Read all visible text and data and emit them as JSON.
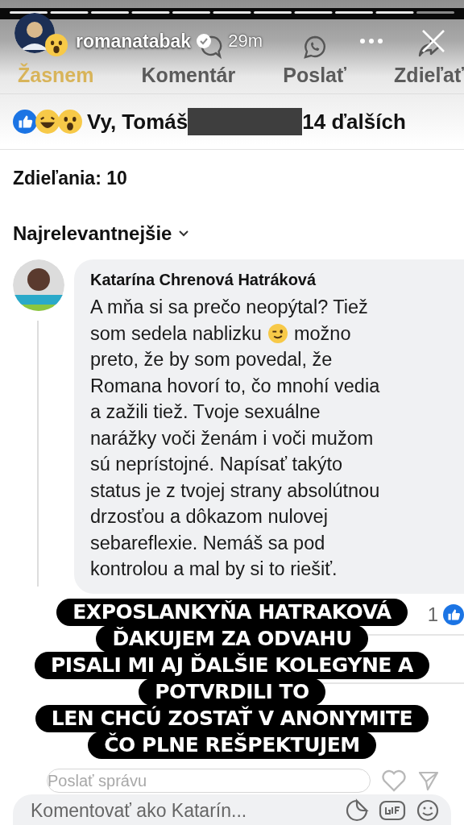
{
  "story": {
    "username": "romanatabak",
    "verified": true,
    "time": "29m"
  },
  "actions": [
    {
      "label": "Žasnem",
      "selected": true,
      "kind": "reaction"
    },
    {
      "label": "Komentár",
      "selected": false,
      "kind": "comment"
    },
    {
      "label": "Poslať",
      "selected": false,
      "kind": "whatsapp"
    },
    {
      "label": "Zdieľať",
      "selected": false,
      "kind": "share"
    }
  ],
  "reactions": {
    "prefix": "Vy, Tomáš",
    "suffix": "14 ďalších"
  },
  "shares": "Zdieľania: 10",
  "sort": "Najrelevantnejšie",
  "comment": {
    "author": "Katarína Chrenová Hatráková",
    "lines": [
      [
        "A mňa si sa prečo neopýtal? Tiež"
      ],
      [
        "som sedela nablizku",
        "možno"
      ],
      [
        "preto, že by som povedal, že"
      ],
      [
        "Romana hovorí to, čo mnohí vedia"
      ],
      [
        "a zažili tiež. Tvoje sexuálne"
      ],
      [
        "narážky voči ženám i voči mužom"
      ],
      [
        "sú neprístojné. Napísať takýto"
      ],
      [
        "status je z tvojej strany absolútnou"
      ],
      [
        "drzosťou a dôkazom nulovej"
      ],
      [
        "sebareflexie. Nemáš sa pod"
      ],
      [
        "kontrolou a mal by si to riešiť."
      ]
    ],
    "likes": "1"
  },
  "captions": [
    "EXPOSLANKYŇA HATRAKOVÁ",
    "ĎAKUJEM ZA ODVAHU",
    "PISALI MI AJ ĎALŠIE KOLEGYNE A",
    "POTVRDILI TO",
    "LEN CHCÚ ZOSTAŤ V ANONYMITE",
    "ČO PLNE REŠPEKTUJEM"
  ],
  "message_field": {
    "placeholder": "Poslať správu"
  },
  "comment_field": {
    "placeholder": "Komentovať ako Katarín..."
  }
}
